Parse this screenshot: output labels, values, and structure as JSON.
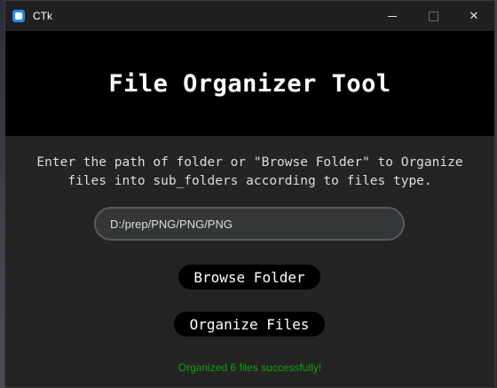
{
  "window": {
    "title": "CTk",
    "controls": {
      "minimize": "minimize-icon",
      "maximize": "maximize-icon",
      "close": "close-icon",
      "close_glyph": "✕"
    }
  },
  "header": {
    "title": "File Organizer Tool",
    "background": "#000000"
  },
  "main": {
    "description_line1": "Enter the path of folder or \"Browse Folder\" to Organize",
    "description_line2": "files into sub_folders according to files type.",
    "path_input": {
      "value": "D:/prep/PNG/PNG/PNG",
      "placeholder": ""
    },
    "browse_button_label": "Browse Folder",
    "organize_button_label": "Organize Files",
    "status_message": "Organized 6 files successfully!"
  },
  "colors": {
    "window_bg": "#242424",
    "button_bg": "#000000",
    "status_color": "#10a010",
    "input_border": "#565b5e"
  }
}
